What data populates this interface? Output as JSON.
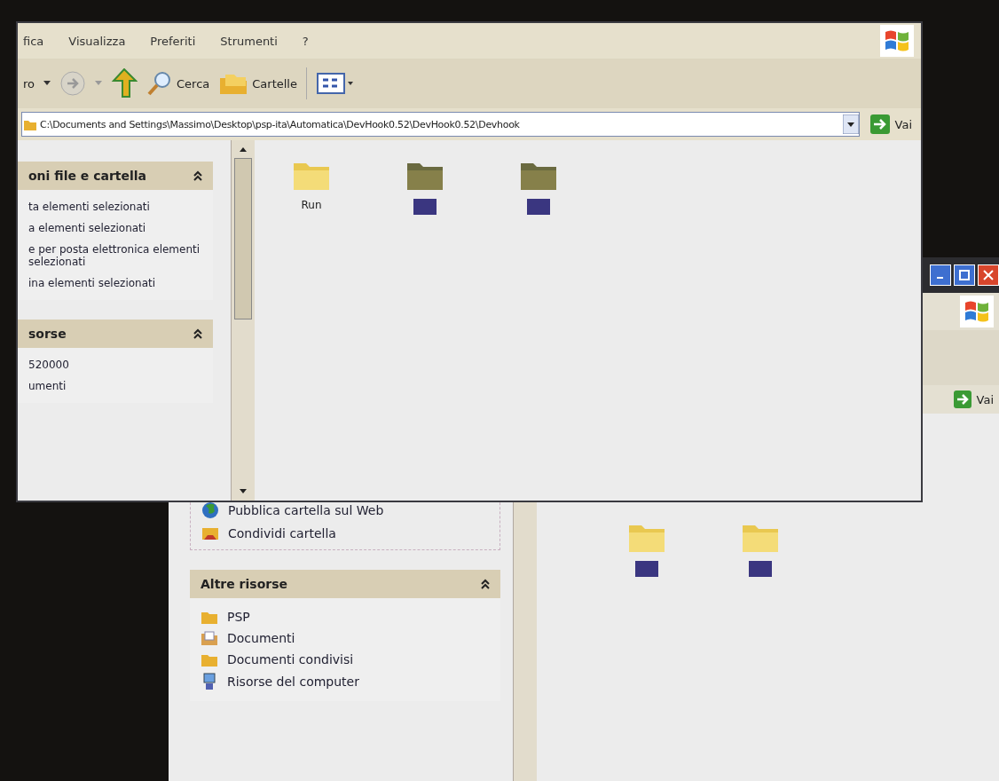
{
  "back_window": {
    "sidebar": {
      "tasks": [
        {
          "label": "Pubblica cartella sul Web",
          "kind": "globe"
        },
        {
          "label": "Condividi cartella",
          "kind": "share"
        }
      ],
      "other_places": {
        "title": "Altre risorse",
        "items": [
          {
            "label": "PSP",
            "kind": "folder"
          },
          {
            "label": "Documenti",
            "kind": "documents"
          },
          {
            "label": "Documenti condivisi",
            "kind": "folder"
          },
          {
            "label": "Risorse del computer",
            "kind": "computer"
          }
        ]
      }
    },
    "address_go": "Vai",
    "folders": [
      {
        "selected": true
      },
      {
        "selected": true
      }
    ]
  },
  "front_window": {
    "menu": [
      "fica",
      "Visualizza",
      "Preferiti",
      "Strumenti",
      "?"
    ],
    "toolbar": {
      "back": "ro",
      "search": "Cerca",
      "folders": "Cartelle"
    },
    "address": "C:\\Documents and Settings\\Massimo\\Desktop\\psp-ita\\Automatica\\DevHook0.52\\DevHook0.52\\Devhook",
    "address_go": "Vai",
    "sidebar": [
      {
        "title": "oni file e cartella",
        "items": [
          "ta elementi selezionati",
          "a elementi selezionati",
          "e per posta elettronica elementi selezionati",
          "ina elementi selezionati"
        ]
      },
      {
        "title": "sorse",
        "items": [
          "520000",
          "umenti"
        ]
      }
    ],
    "folders": [
      {
        "name": "Run",
        "selected": false,
        "dimmed": false
      },
      {
        "selected": true,
        "dimmed": true
      },
      {
        "selected": true,
        "dimmed": true
      }
    ]
  }
}
